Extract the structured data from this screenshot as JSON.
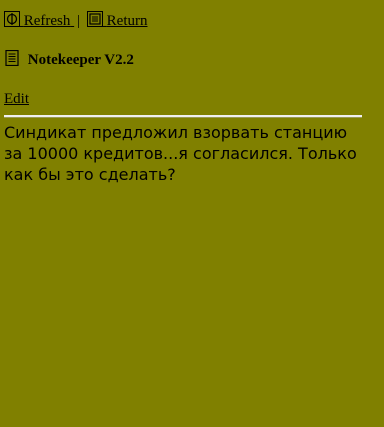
{
  "nav": {
    "refresh_label": "Refresh",
    "separator": "|",
    "return_label": "Return"
  },
  "header": {
    "title": "Notekeeper V2.2"
  },
  "actions": {
    "edit_label": "Edit"
  },
  "note": {
    "text": "Синдикат предложил взорвать станцию за 10000 кредитов...я согласился. Только как бы это сделать?"
  },
  "icons": {
    "refresh": "refresh-icon",
    "return": "return-icon",
    "notebook": "notebook-icon"
  },
  "colors": {
    "background": "#808000",
    "text": "#000000",
    "divider": "#f0f0f0"
  }
}
